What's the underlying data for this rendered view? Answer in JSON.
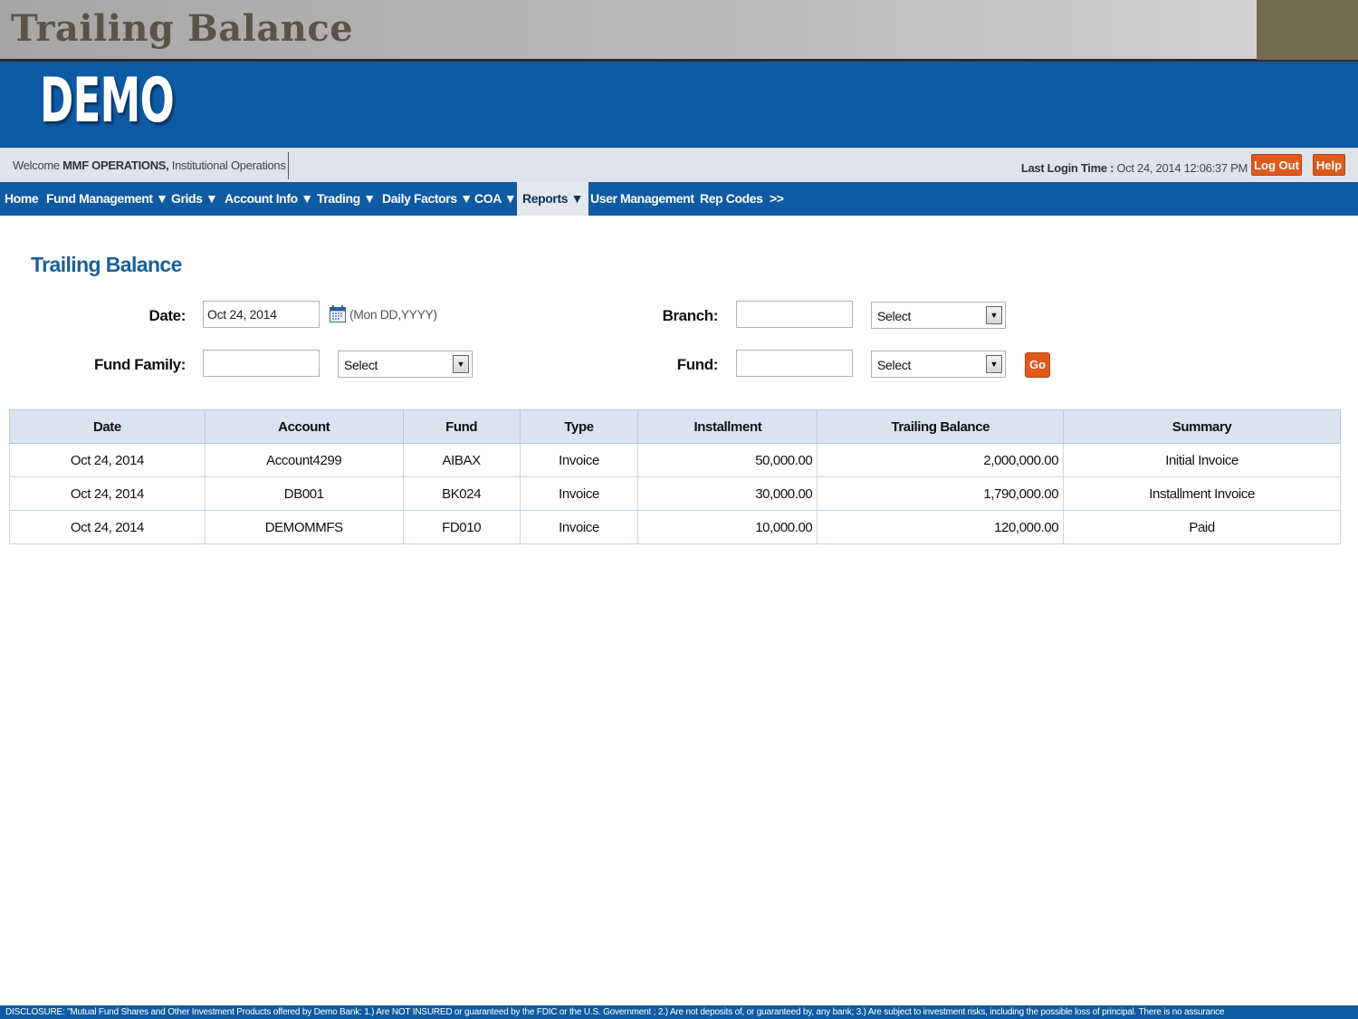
{
  "slide": {
    "title": "Trailing Balance"
  },
  "brand": {
    "logo": "DEMO"
  },
  "welcome": {
    "prefix": "Welcome",
    "user": "MMF OPERATIONS,",
    "org": "Institutional Operations",
    "last_login_label": "Last Login Time :",
    "last_login_value": "Oct 24, 2014 12:06:37 PM",
    "logout_label": "Log Out",
    "help_label": "Help"
  },
  "nav": {
    "items": [
      {
        "label": "Home"
      },
      {
        "label": "Fund Management ▼"
      },
      {
        "label": "Grids ▼"
      },
      {
        "label": "Account Info ▼"
      },
      {
        "label": "Trading ▼"
      },
      {
        "label": "Daily Factors ▼"
      },
      {
        "label": "COA ▼"
      },
      {
        "label": "Reports ▼",
        "active": true
      },
      {
        "label": "User Management"
      },
      {
        "label": "Rep Codes"
      },
      {
        "label": ">>"
      }
    ]
  },
  "page": {
    "heading": "Trailing Balance"
  },
  "form": {
    "date_label": "Date:",
    "date_value": "Oct 24, 2014",
    "date_format_hint": "(Mon DD,YYYY)",
    "branch_label": "Branch:",
    "branch_value": "",
    "branch_select": "Select",
    "fund_family_label": "Fund Family:",
    "fund_family_value": "",
    "fund_family_select": "Select",
    "fund_label": "Fund:",
    "fund_value": "",
    "fund_select": "Select",
    "go_label": "Go"
  },
  "table": {
    "columns": [
      "Date",
      "Account",
      "Fund",
      "Type",
      "Installment",
      "Trailing Balance",
      "Summary"
    ],
    "rows": [
      [
        "Oct 24, 2014",
        "Account4299",
        "AIBAX",
        "Invoice",
        "50,000.00",
        "2,000,000.00",
        "Initial Invoice"
      ],
      [
        "Oct 24, 2014",
        "DB001",
        "BK024",
        "Invoice",
        "30,000.00",
        "1,790,000.00",
        "Installment Invoice"
      ],
      [
        "Oct 24, 2014",
        "DEMOMMFS",
        "FD010",
        "Invoice",
        "10,000.00",
        "120,000.00",
        "Paid"
      ]
    ]
  },
  "footer": {
    "disclosure": "DISCLOSURE: \"Mutual Fund Shares and Other Investment Products offered by Demo Bank: 1.) Are NOT INSURED or guaranteed by the FDIC or the U.S. Government ; 2.) Are not deposits of, or guaranteed by, any bank; 3.) Are subject to investment risks, including the possible loss of principal. There is no assurance"
  },
  "colors": {
    "brand_blue": "#0e5aa3",
    "accent_orange": "#e0591b",
    "heading_blue": "#1b5f98",
    "header_row": "#d9e4f0"
  }
}
